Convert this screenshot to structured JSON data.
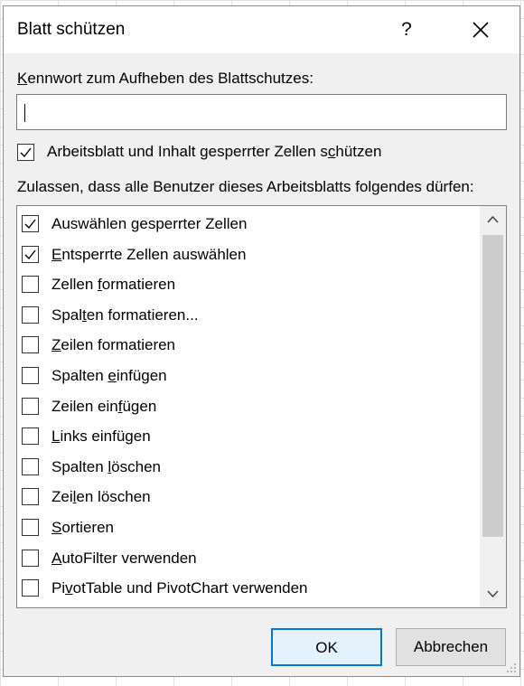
{
  "dialog": {
    "title": "Blatt schützen",
    "help_label": "?",
    "password": {
      "label_first": "K",
      "label_rest": "ennwort zum Aufheben des Blattschutzes:",
      "value": ""
    },
    "protect_checkbox": {
      "pre": "Arbeitsblatt und Inhalt gesperrter Zellen s",
      "u": "c",
      "post": "hützen",
      "checked": true
    },
    "allow_label": "Zulassen, dass alle Benutzer dieses Arbeitsblatts folgendes dürfen:",
    "permissions": [
      {
        "pre": "Auswählen ",
        "u": "g",
        "post": "esperrter Zellen",
        "checked": true
      },
      {
        "pre": "",
        "u": "E",
        "post": "ntsperrte Zellen auswählen",
        "checked": true
      },
      {
        "pre": "Zellen ",
        "u": "f",
        "post": "ormatieren",
        "checked": false
      },
      {
        "pre": "Spal",
        "u": "t",
        "post": "en formatieren...",
        "checked": false
      },
      {
        "pre": "",
        "u": "Z",
        "post": "eilen formatieren",
        "checked": false
      },
      {
        "pre": "Spalten ",
        "u": "e",
        "post": "infügen",
        "checked": false
      },
      {
        "pre": "Zeilen ein",
        "u": "f",
        "post": "ügen",
        "checked": false
      },
      {
        "pre": "",
        "u": "L",
        "post": "inks einfügen",
        "checked": false
      },
      {
        "pre": "Spalten ",
        "u": "l",
        "post": "öschen",
        "checked": false
      },
      {
        "pre": "Zei",
        "u": "l",
        "post": "en löschen",
        "checked": false
      },
      {
        "pre": "",
        "u": "S",
        "post": "ortieren",
        "checked": false
      },
      {
        "pre": "",
        "u": "A",
        "post": "utoFilter verwenden",
        "checked": false
      },
      {
        "pre": "Pi",
        "u": "v",
        "post": "otTable und PivotChart verwenden",
        "checked": false
      }
    ],
    "ok_label": "OK",
    "cancel_label": "Abbrechen"
  }
}
